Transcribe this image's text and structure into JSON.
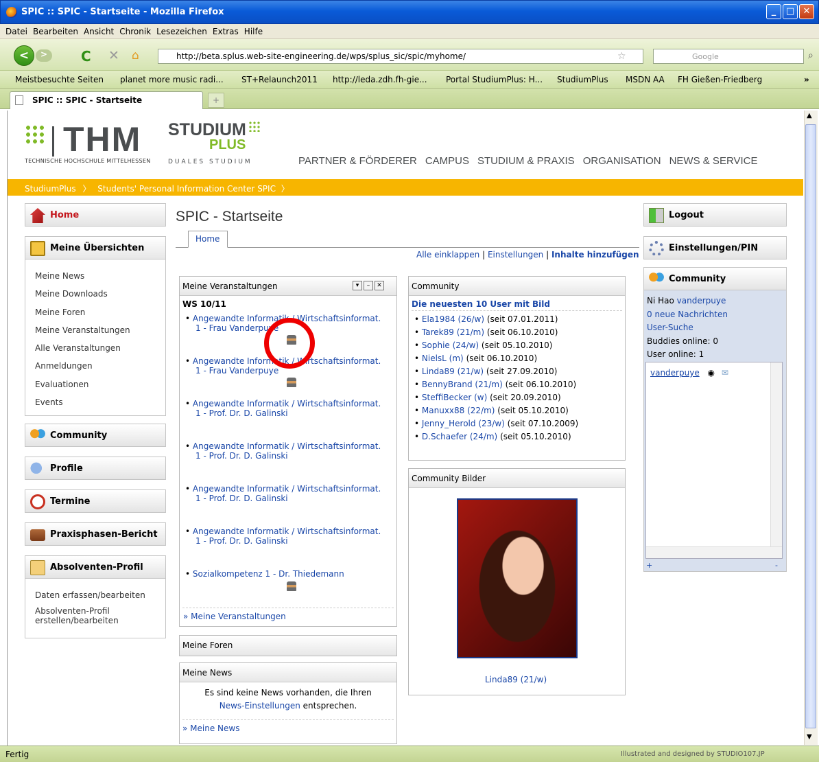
{
  "window": {
    "title": "SPIC :: SPIC - Startseite - Mozilla Firefox"
  },
  "menu": [
    "Datei",
    "Bearbeiten",
    "Ansicht",
    "Chronik",
    "Lesezeichen",
    "Extras",
    "Hilfe"
  ],
  "browser": {
    "url": "http://beta.splus.web-site-engineering.de/wps/splus_sic/spic/myhome/",
    "search_placeholder": "Google"
  },
  "bookmarks": [
    "Meistbesuchte Seiten",
    "planet more music radi...",
    "ST+Relaunch2011",
    "http://leda.zdh.fh-gie...",
    "Portal StudiumPlus: H...",
    "StudiumPlus",
    "MSDN AA",
    "FH Gießen-Friedberg"
  ],
  "tab": {
    "label": "SPIC :: SPIC - Startseite"
  },
  "status": {
    "left": "Fertig",
    "right": "Illustrated and designed by STUDIO107.JP"
  },
  "header": {
    "thm": "THM",
    "thm_sub": "TECHNISCHE HOCHSCHULE MITTELHESSEN",
    "sp1": "STUDIUM",
    "sp2": "PLUS",
    "sp3": "DUALES STUDIUM",
    "nav": [
      "PARTNER & FÖRDERER",
      "CAMPUS",
      "STUDIUM & PRAXIS",
      "ORGANISATION",
      "NEWS & SERVICE"
    ]
  },
  "breadcrumb": [
    "StudiumPlus",
    "Students' Personal Information Center SPIC"
  ],
  "leftnav": {
    "home": "Home",
    "uebersichten": "Meine Übersichten",
    "uebersichten_items": [
      "Meine News",
      "Meine Downloads",
      "Meine Foren",
      "Meine Veranstaltungen",
      "Alle Veranstaltungen",
      "Anmeldungen",
      "Evaluationen",
      "Events"
    ],
    "community": "Community",
    "profile": "Profile",
    "termine": "Termine",
    "praxis": "Praxisphasen-Bericht",
    "absolventen": "Absolventen-Profil",
    "absolventen_items": [
      "Daten erfassen/bearbeiten",
      "Absolventen-Profil erstellen/bearbeiten"
    ]
  },
  "main": {
    "title": "SPIC - Startseite",
    "tab": "Home",
    "actions": {
      "collapse": "Alle einklappen",
      "sep1": " | ",
      "settings": "Einstellungen",
      "sep2": " | ",
      "add": "Inhalte hinzufügen"
    },
    "veranstaltungen": {
      "title": "Meine Veranstaltungen",
      "semester": "WS 10/11",
      "items": [
        {
          "l1": "Angewandte Informatik / Wirtschaftsinformat.",
          "l2": "1 - Frau Vanderpuye"
        },
        {
          "l1": "Angewandte Informatik / Wirtschaftsinformat.",
          "l2": "1 - Frau Vanderpuye"
        },
        {
          "l1": "Angewandte Informatik / Wirtschaftsinformat.",
          "l2": "1 - Prof. Dr. D. Galinski"
        },
        {
          "l1": "Angewandte Informatik / Wirtschaftsinformat.",
          "l2": "1 - Prof. Dr. D. Galinski"
        },
        {
          "l1": "Angewandte Informatik / Wirtschaftsinformat.",
          "l2": "1 - Prof. Dr. D. Galinski"
        },
        {
          "l1": "Angewandte Informatik / Wirtschaftsinformat.",
          "l2": "1 - Prof. Dr. D. Galinski"
        },
        {
          "l1": "Sozialkompetenz 1 - Dr. Thiedemann",
          "l2": ""
        }
      ],
      "more": "» Meine Veranstaltungen"
    },
    "foren": {
      "title": "Meine Foren"
    },
    "news": {
      "title": "Meine News",
      "text1": "Es sind keine News vorhanden, die Ihren",
      "link": "News-Einstellungen",
      "text2": " entsprechen.",
      "more": "» Meine News"
    },
    "community": {
      "title": "Community",
      "heading": "Die neuesten 10 User mit Bild",
      "users": [
        {
          "name": "Ela1984 (26/w)",
          "since": " (seit 07.01.2011)"
        },
        {
          "name": "Tarek89 (21/m)",
          "since": " (seit 06.10.2010)"
        },
        {
          "name": "Sophie (24/w)",
          "since": " (seit 05.10.2010)"
        },
        {
          "name": "NielsL (m)",
          "since": " (seit 06.10.2010)"
        },
        {
          "name": "Linda89 (21/w)",
          "since": " (seit 27.09.2010)"
        },
        {
          "name": "BennyBrand (21/m)",
          "since": " (seit 06.10.2010)"
        },
        {
          "name": "SteffiBecker (w)",
          "since": " (seit 20.09.2010)"
        },
        {
          "name": "Manuxx88 (22/m)",
          "since": " (seit 05.10.2010)"
        },
        {
          "name": "Jenny_Herold (23/w)",
          "since": " (seit 07.10.2009)"
        },
        {
          "name": "D.Schaefer (24/m)",
          "since": " (seit 05.10.2010)"
        }
      ]
    },
    "bilder": {
      "title": "Community Bilder",
      "caption": "Linda89 (21/w)"
    }
  },
  "right": {
    "logout": "Logout",
    "pin": "Einstellungen/PIN",
    "community": "Community",
    "greeting": "Ni Hao ",
    "user": "vanderpuye",
    "messages": "0 neue Nachrichten",
    "search": "User-Suche",
    "buddies": "Buddies online: 0",
    "online": "User online: 1",
    "plus": "+",
    "minus": "-"
  }
}
